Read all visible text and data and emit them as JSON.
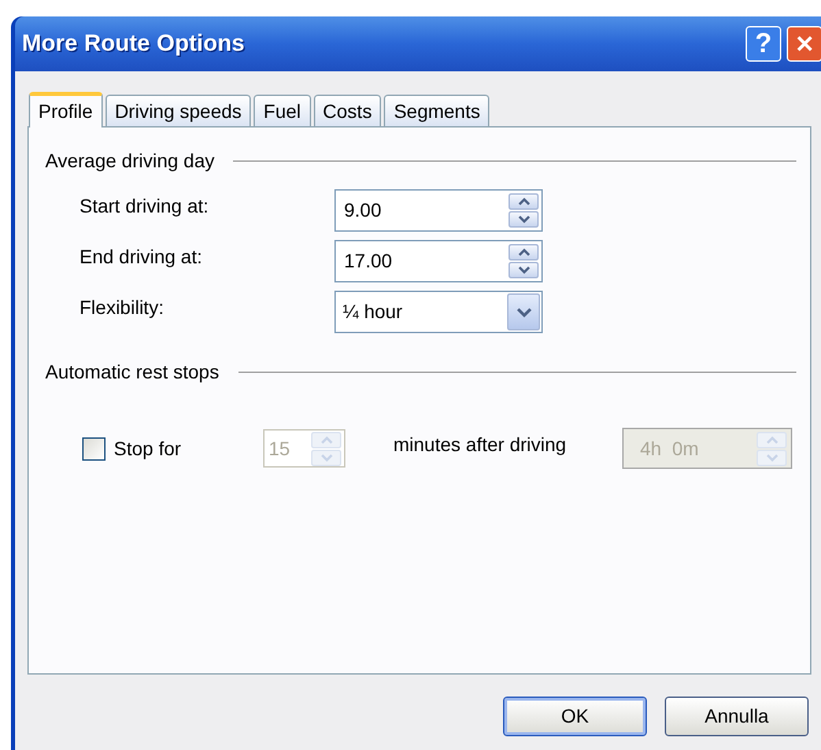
{
  "window": {
    "title": "More Route Options",
    "help": "?",
    "close": "✕"
  },
  "tabs": [
    {
      "label": "Profile",
      "selected": true
    },
    {
      "label": "Driving speeds",
      "selected": false
    },
    {
      "label": "Fuel",
      "selected": false
    },
    {
      "label": "Costs",
      "selected": false
    },
    {
      "label": "Segments",
      "selected": false
    }
  ],
  "driving_day": {
    "heading": "Average driving day",
    "fields": [
      {
        "label": "Start driving at:",
        "value": "9.00",
        "kind": "spin"
      },
      {
        "label": "End driving at:",
        "value": "17.00",
        "kind": "spin"
      },
      {
        "label": "Flexibility:",
        "value": "¼ hour",
        "kind": "dropdown"
      }
    ]
  },
  "rest_stops": {
    "heading": "Automatic rest stops",
    "checkbox": {
      "label": "Stop for",
      "checked": false
    },
    "minutes": {
      "value": "15",
      "disabled": true
    },
    "after_label": "minutes after driving",
    "duration": {
      "value": "4h  0m",
      "disabled": true
    }
  },
  "buttons": [
    {
      "label": "OK",
      "default": true
    },
    {
      "label": "Annulla",
      "default": false
    }
  ]
}
